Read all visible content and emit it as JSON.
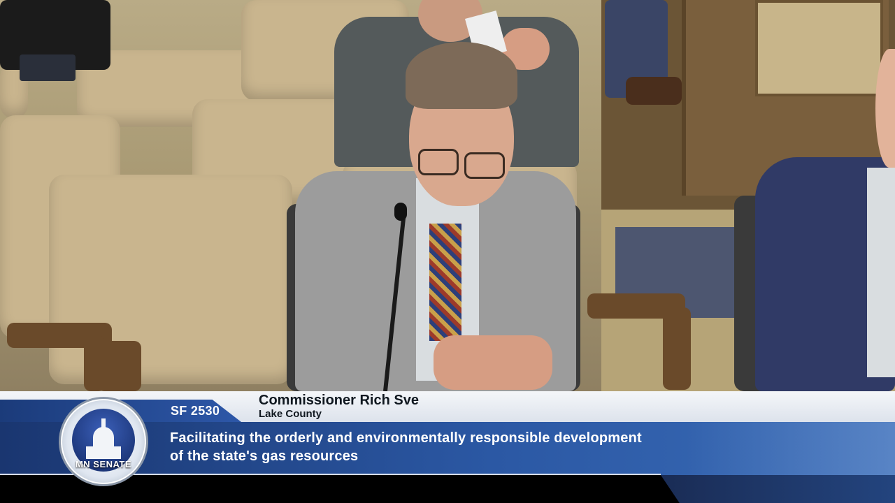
{
  "lower_third": {
    "bill_number": "SF 2530",
    "speaker_name": "Commissioner Rich Sve",
    "speaker_affiliation": "Lake County",
    "caption_line1": "Facilitating the orderly and environmentally responsible development",
    "caption_line2": "of the state's gas resources"
  },
  "seal": {
    "text": "MN SENATE"
  },
  "colors": {
    "banner_blue": "#2b58a4",
    "banner_dark": "#1a3670",
    "strip_light": "#eef1f6"
  }
}
